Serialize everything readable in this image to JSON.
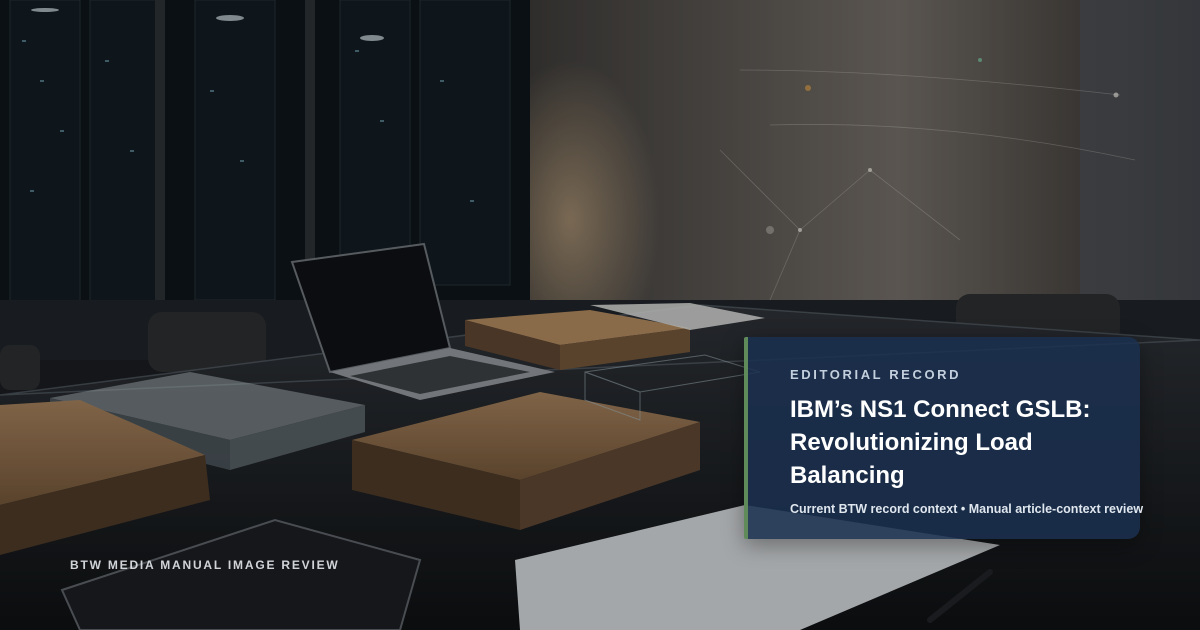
{
  "card": {
    "eyebrow": "EDITORIAL RECORD",
    "headline": "IBM’s NS1 Connect GSLB: Revolutionizing Load Balancing",
    "meta": "Current BTW record context • Manual article-context review"
  },
  "watermark": "BTW MEDIA MANUAL IMAGE REVIEW",
  "colors": {
    "card_background": "#1b304f",
    "card_accent": "#5f8a5a",
    "text_primary": "#ffffff"
  }
}
